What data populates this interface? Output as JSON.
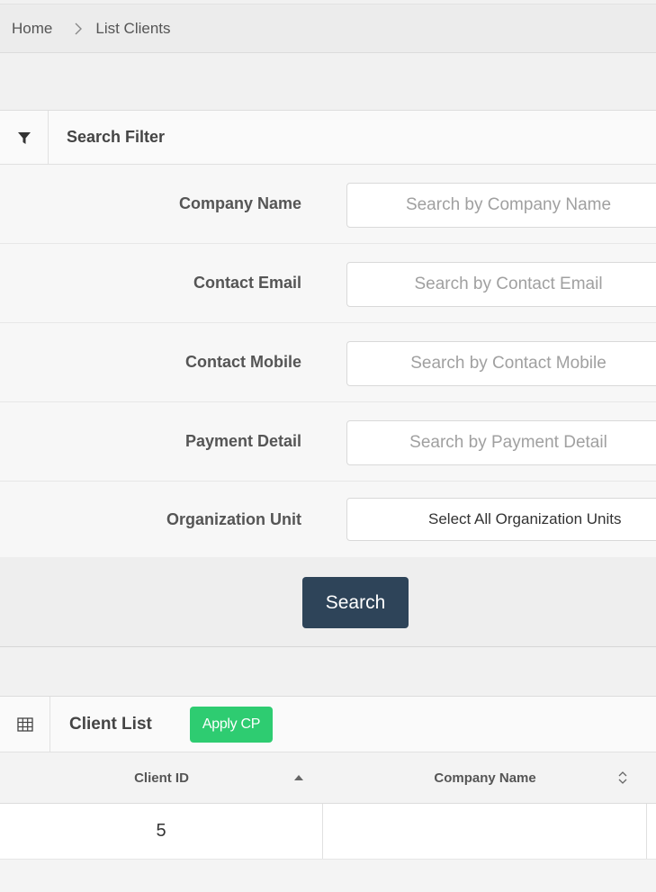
{
  "breadcrumb": {
    "home": "Home",
    "current": "List Clients"
  },
  "filter": {
    "title": "Search Filter",
    "fields": [
      {
        "label": "Company Name",
        "placeholder": "Search by Company Name"
      },
      {
        "label": "Contact Email",
        "placeholder": "Search by Contact Email"
      },
      {
        "label": "Contact Mobile",
        "placeholder": "Search by Contact Mobile"
      },
      {
        "label": "Payment Detail",
        "placeholder": "Search by Payment Detail"
      }
    ],
    "org_unit": {
      "label": "Organization Unit",
      "value": "Select All Organization Units"
    },
    "search_label": "Search"
  },
  "client_list": {
    "title": "Client List",
    "apply_label": "Apply CP",
    "columns": [
      "Client ID",
      "Company Name"
    ],
    "rows": [
      {
        "client_id": "5",
        "company_name": ""
      }
    ]
  }
}
